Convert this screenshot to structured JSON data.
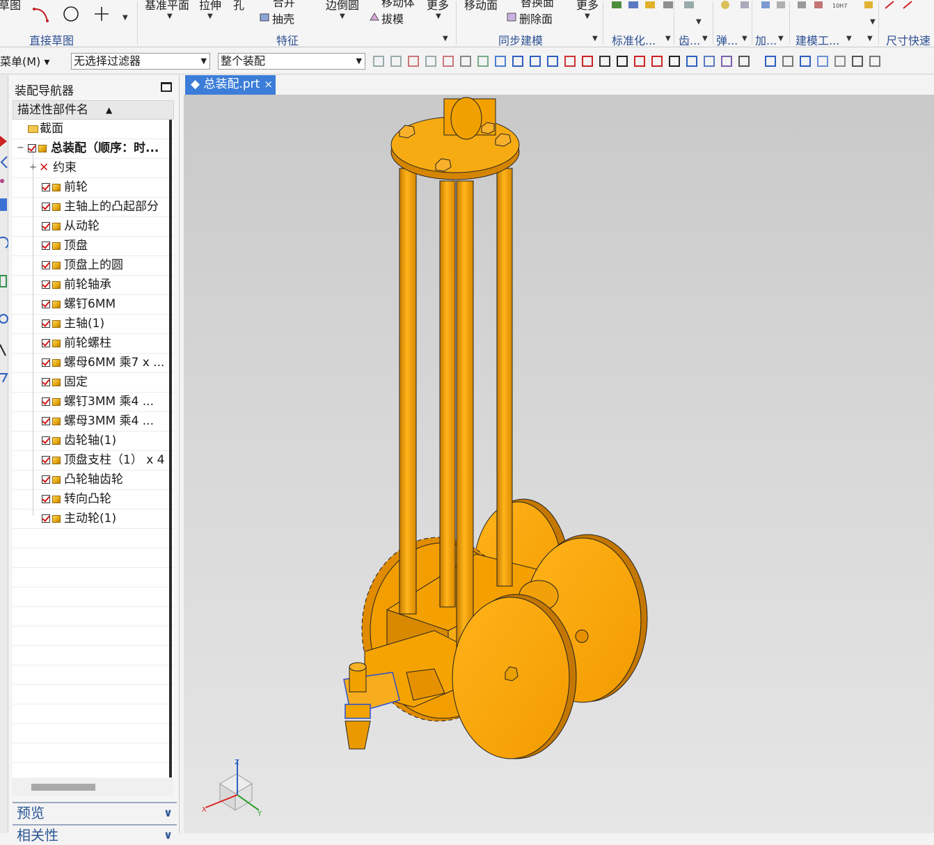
{
  "ribbon": {
    "top_labels": [
      "草图",
      "基准平面",
      "拉伸",
      "孔",
      "合并",
      "抽壳",
      "边倒圆",
      "移动体",
      "拔模",
      "更多",
      "移动面",
      "替换面",
      "删除面",
      "更多"
    ],
    "groups": [
      "直接草图",
      "特征",
      "同步建模",
      "标准化...",
      "齿...",
      "弹...",
      "加...",
      "建模工...",
      "尺寸快速"
    ],
    "shell_label": "抽壳",
    "draft_label": "拔模",
    "delete_face_label": "删除面",
    "fit_label": "10H7"
  },
  "toolbar": {
    "menu_label": "菜单(M)",
    "selection_filter": "无选择过滤器",
    "assembly_scope": "整个装配"
  },
  "navigator": {
    "title": "装配导航器",
    "column_header": "描述性部件名",
    "items": [
      {
        "label": "截面",
        "kind": "folder"
      },
      {
        "label": "总装配（顺序：时...",
        "kind": "assembly"
      },
      {
        "label": "约束",
        "kind": "constraints"
      },
      {
        "label": "前轮",
        "kind": "part"
      },
      {
        "label": "主轴上的凸起部分",
        "kind": "part"
      },
      {
        "label": "从动轮",
        "kind": "part"
      },
      {
        "label": "顶盘",
        "kind": "part"
      },
      {
        "label": "顶盘上的圆",
        "kind": "part"
      },
      {
        "label": "前轮轴承",
        "kind": "part"
      },
      {
        "label": "螺钉6MM",
        "kind": "part"
      },
      {
        "label": "主轴(1)",
        "kind": "part"
      },
      {
        "label": "前轮螺柱",
        "kind": "part"
      },
      {
        "label": "螺母6MM  乘7 x ...",
        "kind": "part"
      },
      {
        "label": "固定",
        "kind": "part"
      },
      {
        "label": "螺钉3MM    乘4 ...",
        "kind": "part"
      },
      {
        "label": "螺母3MM    乘4 ...",
        "kind": "part"
      },
      {
        "label": "齿轮轴(1)",
        "kind": "part"
      },
      {
        "label": "顶盘支柱（1） x 4",
        "kind": "part"
      },
      {
        "label": "凸轮轴齿轮",
        "kind": "part"
      },
      {
        "label": "转向凸轮",
        "kind": "part"
      },
      {
        "label": "主动轮(1)",
        "kind": "part"
      }
    ],
    "sections": [
      "预览",
      "相关性"
    ]
  },
  "tab": {
    "label": "总装配.prt"
  },
  "axes": {
    "x": "X",
    "y": "Y",
    "z": "Z"
  },
  "colors": {
    "part": "#f4a400",
    "part_dark": "#c77d00",
    "accent": "#3b7dd8",
    "group_text": "#2c4f93"
  }
}
